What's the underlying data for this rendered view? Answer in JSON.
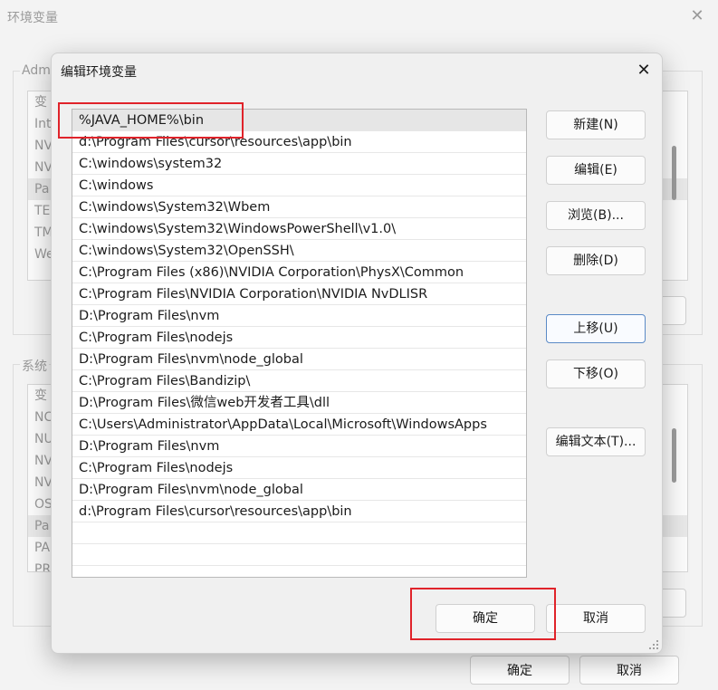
{
  "background": {
    "title": "环境变量",
    "user_group_label": "Adm",
    "user_vars": [
      "变",
      "Int",
      "NV",
      "NV",
      "Pa",
      "TE",
      "TM",
      "We"
    ],
    "system_group_label": "系统",
    "system_vars": [
      "变",
      "NC",
      "NU",
      "NV",
      "NV",
      "OS",
      "Pa",
      "PA",
      "PR"
    ],
    "ok_label": "确定",
    "cancel_label": "取消"
  },
  "dialog": {
    "title": "编辑环境变量",
    "paths": [
      "%JAVA_HOME%\\bin",
      "d:\\Program Files\\cursor\\resources\\app\\bin",
      "C:\\windows\\system32",
      "C:\\windows",
      "C:\\windows\\System32\\Wbem",
      "C:\\windows\\System32\\WindowsPowerShell\\v1.0\\",
      "C:\\windows\\System32\\OpenSSH\\",
      "C:\\Program Files (x86)\\NVIDIA Corporation\\PhysX\\Common",
      "C:\\Program Files\\NVIDIA Corporation\\NVIDIA NvDLISR",
      "D:\\Program Files\\nvm",
      "C:\\Program Files\\nodejs",
      "D:\\Program Files\\nvm\\node_global",
      "C:\\Program Files\\Bandizip\\",
      "D:\\Program Files\\微信web开发者工具\\dll",
      "C:\\Users\\Administrator\\AppData\\Local\\Microsoft\\WindowsApps",
      "D:\\Program Files\\nvm",
      "C:\\Program Files\\nodejs",
      "D:\\Program Files\\nvm\\node_global",
      "d:\\Program Files\\cursor\\resources\\app\\bin",
      "",
      ""
    ],
    "buttons": {
      "new": "新建(N)",
      "edit": "编辑(E)",
      "browse": "浏览(B)...",
      "delete": "删除(D)",
      "move_up": "上移(U)",
      "move_down": "下移(O)",
      "edit_text": "编辑文本(T)..."
    },
    "ok_label": "确定",
    "cancel_label": "取消"
  },
  "colors": {
    "highlight": "#e0232a",
    "focus_border": "#5b8ac6"
  }
}
